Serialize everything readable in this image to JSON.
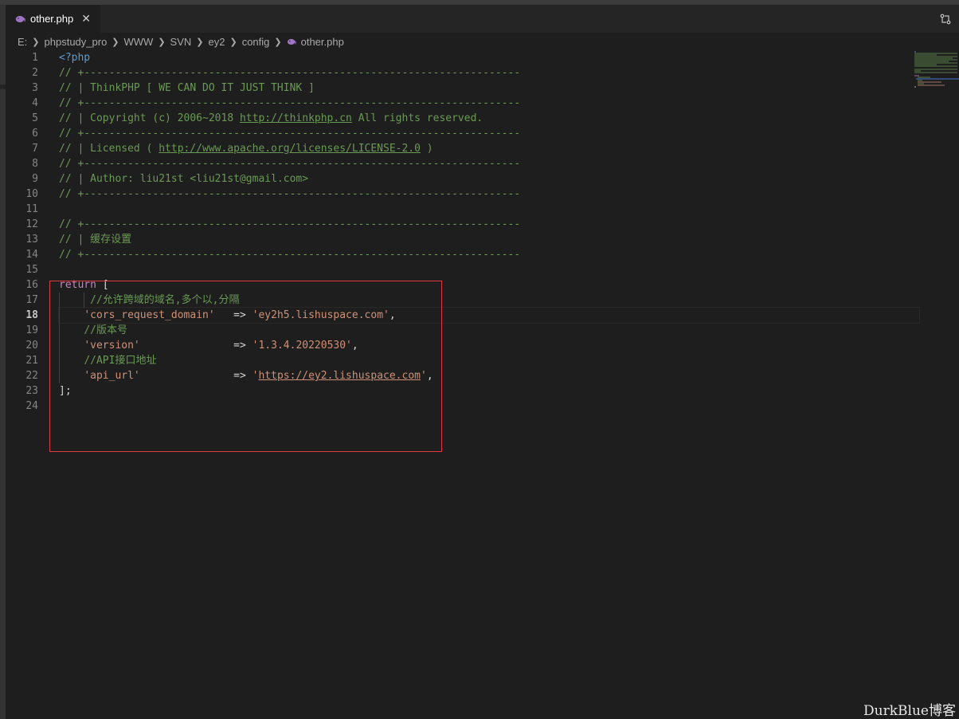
{
  "tab": {
    "filename": "other.php",
    "close_glyph": "✕"
  },
  "breadcrumb": [
    "E:",
    "phpstudy_pro",
    "WWW",
    "SVN",
    "ey2",
    "config",
    "other.php"
  ],
  "code": {
    "line_numbers": [
      "1",
      "2",
      "3",
      "4",
      "5",
      "6",
      "7",
      "8",
      "9",
      "10",
      "11",
      "12",
      "13",
      "14",
      "15",
      "16",
      "17",
      "18",
      "19",
      "20",
      "21",
      "22",
      "23",
      "24"
    ],
    "l1": "<?php",
    "l2": "// +----------------------------------------------------------------------",
    "l3": "// | ThinkPHP [ WE CAN DO IT JUST THINK ]",
    "l4": "// +----------------------------------------------------------------------",
    "l5_pre": "// | Copyright (c) 2006~2018 ",
    "l5_url": "http://thinkphp.cn",
    "l5_post": " All rights reserved.",
    "l6": "// +----------------------------------------------------------------------",
    "l7_pre": "// | Licensed ( ",
    "l7_url": "http://www.apache.org/licenses/LICENSE-2.0",
    "l7_post": " )",
    "l8": "// +----------------------------------------------------------------------",
    "l9": "// | Author: liu21st <liu21st@gmail.com>",
    "l10": "// +----------------------------------------------------------------------",
    "l12": "// +----------------------------------------------------------------------",
    "l13": "// | 缓存设置",
    "l14": "// +----------------------------------------------------------------------",
    "l16_kw": "return",
    "l16_rest": " [",
    "l17": "//允许跨域的域名,多个以,分隔",
    "l18_key": "'cors_request_domain'",
    "l18_arrow": "   => ",
    "l18_val": "'ey2h5.lishuspace.com'",
    "l18_end": ",",
    "l19": "//版本号",
    "l20_key": "'version'",
    "l20_arrow": "               => ",
    "l20_val": "'1.3.4.20220530'",
    "l20_end": ",",
    "l21": "//API接口地址",
    "l22_key": "'api_url'",
    "l22_arrow": "               => ",
    "l22_q1": "'",
    "l22_url": "https://ey2.lishuspace.com",
    "l22_q2": "'",
    "l22_end": ",",
    "l23": "];"
  },
  "watermark": "DurkBlue博客",
  "colors": {
    "comment": "#6a9955",
    "keyword": "#c586c0",
    "string": "#ce9178",
    "php_tag": "#569cd6",
    "annotation_box": "#e0383e"
  }
}
